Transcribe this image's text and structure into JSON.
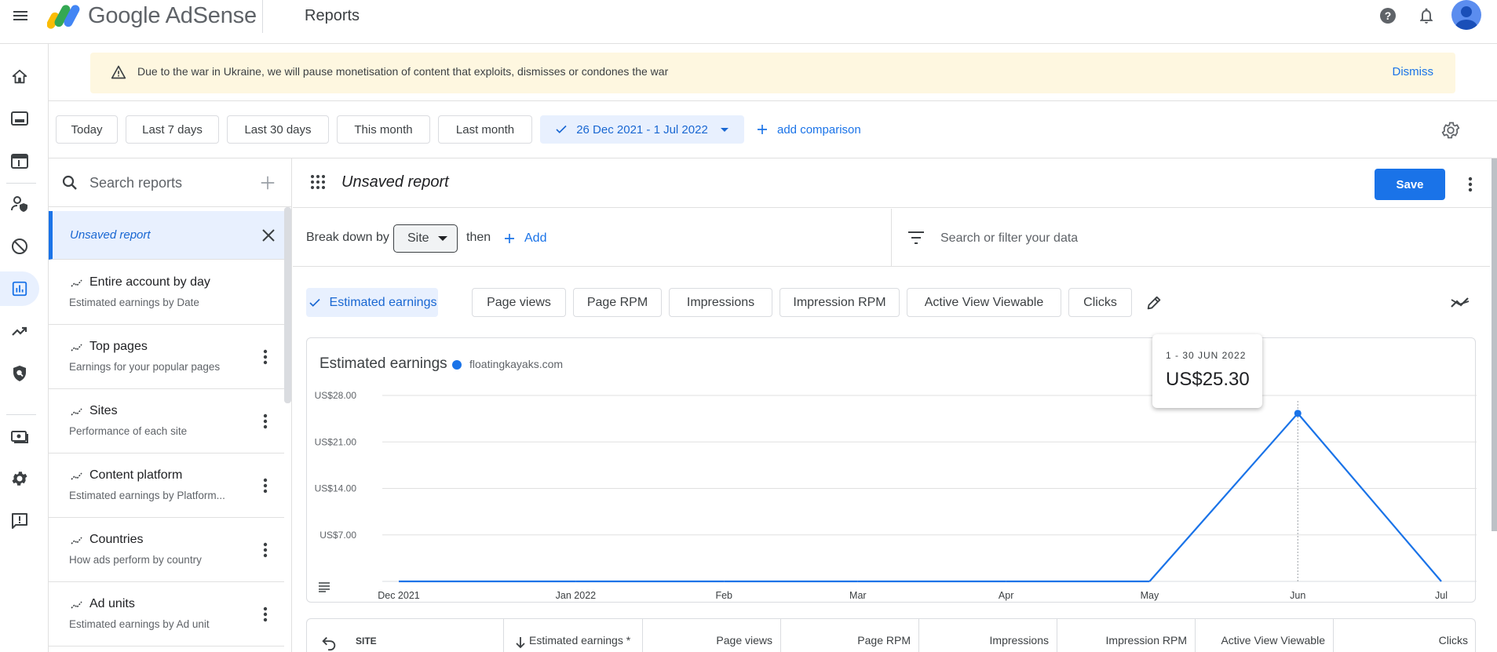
{
  "app": {
    "name": "Google AdSense",
    "page_title": "Reports"
  },
  "banner": {
    "message": "Due to the war in Ukraine, we will pause monetisation of content that exploits, dismisses or condones the war",
    "dismiss_label": "Dismiss"
  },
  "date_chips": [
    "Today",
    "Last 7 days",
    "Last 30 days",
    "This month",
    "Last month"
  ],
  "date_range": "26 Dec 2021 - 1 Jul 2022",
  "add_comparison": "add comparison",
  "reports_sidebar": {
    "search_placeholder": "Search reports",
    "current": "Unsaved report",
    "items": [
      {
        "title": "Entire account by day",
        "subtitle": "Estimated earnings by Date"
      },
      {
        "title": "Top pages",
        "subtitle": "Earnings for your popular pages"
      },
      {
        "title": "Sites",
        "subtitle": "Performance of each site"
      },
      {
        "title": "Content platform",
        "subtitle": "Estimated earnings by Platform..."
      },
      {
        "title": "Countries",
        "subtitle": "How ads perform by country"
      },
      {
        "title": "Ad units",
        "subtitle": "Estimated earnings by Ad unit"
      }
    ]
  },
  "report": {
    "name": "Unsaved report",
    "save_label": "Save",
    "breakdown_label": "Break down by",
    "breakdown_value": "Site",
    "then_label": "then",
    "add_label": "Add",
    "filter_placeholder": "Search or filter your data"
  },
  "metrics": {
    "selected": "Estimated earnings",
    "others": [
      "Page views",
      "Page RPM",
      "Impressions",
      "Impression RPM",
      "Active View Viewable",
      "Clicks"
    ]
  },
  "chart": {
    "legend": "floatingkayaks.com",
    "tooltip_date": "1 - 30 JUN 2022",
    "tooltip_value": "US$25.30"
  },
  "chart_data": {
    "type": "line",
    "title": "Estimated earnings",
    "x": [
      "Dec 2021",
      "Jan 2022",
      "Feb",
      "Mar",
      "Apr",
      "May",
      "Jun",
      "Jul"
    ],
    "series": [
      {
        "name": "floatingkayaks.com",
        "values": [
          0,
          0,
          0,
          0,
          0,
          0,
          25.3,
          0
        ]
      }
    ],
    "y_ticks": [
      "US$28.00",
      "US$21.00",
      "US$14.00",
      "US$7.00"
    ],
    "ylim": [
      0,
      28
    ],
    "grid": true,
    "color": "#1a73e8"
  },
  "table": {
    "columns": [
      "SITE",
      "Estimated earnings *",
      "Page views",
      "Page RPM",
      "Impressions",
      "Impression RPM",
      "Active View Viewable",
      "Clicks"
    ]
  },
  "colors": {
    "accent": "#1a73e8",
    "banner_bg": "#fef7e0",
    "selected_bg": "#e8f0fe"
  }
}
